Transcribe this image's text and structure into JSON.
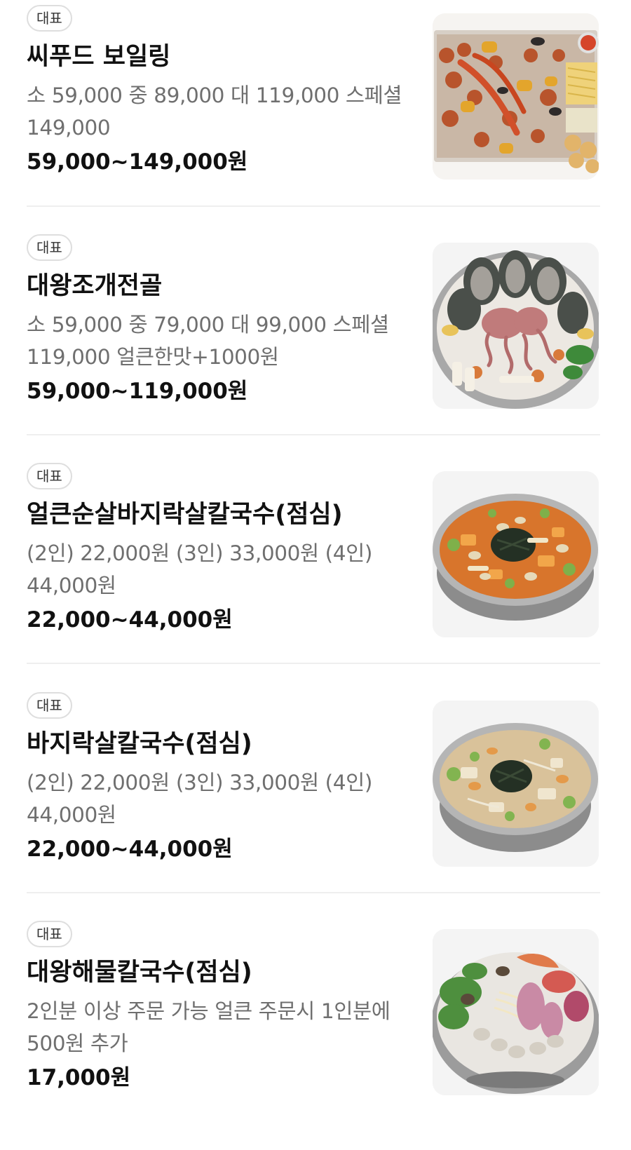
{
  "menu": {
    "items": [
      {
        "badge": "대표",
        "title": "씨푸드 보일링",
        "desc": "소 59,000 중 89,000 대 119,000 스페셜 149,000",
        "price": "59,000~149,000원",
        "image": "seafood-boil-platter"
      },
      {
        "badge": "대표",
        "title": "대왕조개전골",
        "desc": "소 59,000 중 79,000 대 99,000 스페셜 119,000 얼큰한맛+1000원",
        "price": "59,000~119,000원",
        "image": "giant-clam-hotpot"
      },
      {
        "badge": "대표",
        "title": "얼큰순살바지락살칼국수(점심)",
        "desc": "(2인) 22,000원 (3인) 33,000원 (4인) 44,000원",
        "price": "22,000~44,000원",
        "image": "spicy-clam-noodle-soup"
      },
      {
        "badge": "대표",
        "title": "바지락살칼국수(점심)",
        "desc": "(2인) 22,000원 (3인) 33,000원 (4인) 44,000원",
        "price": "22,000~44,000원",
        "image": "clam-noodle-soup"
      },
      {
        "badge": "대표",
        "title": "대왕해물칼국수(점심)",
        "desc": "2인분 이상 주문 가능 얼큰 주문시 1인분에 500원 추가",
        "price": "17,000원",
        "image": "giant-seafood-noodle-soup"
      }
    ]
  }
}
